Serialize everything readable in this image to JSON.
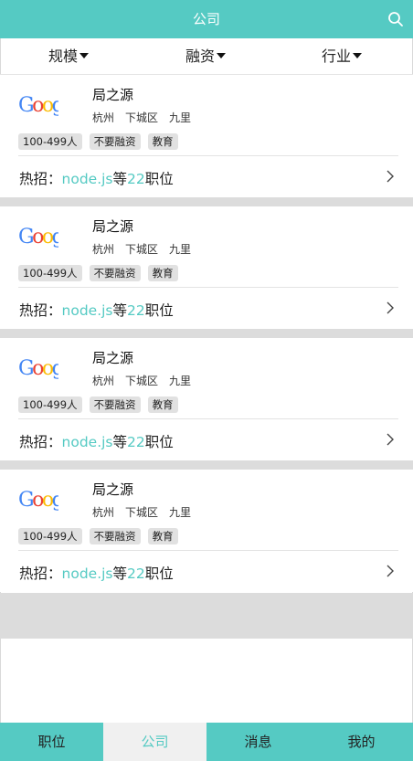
{
  "header": {
    "title": "公司"
  },
  "filters": [
    {
      "label": "规模"
    },
    {
      "label": "融资"
    },
    {
      "label": "行业"
    }
  ],
  "companies": [
    {
      "name": "局之源",
      "city": "杭州",
      "district": "下城区",
      "area": "九里",
      "tags": [
        "100-499人",
        "不要融资",
        "教育"
      ],
      "hot_prefix": "热招：",
      "hot_skill": "node.js",
      "hot_mid": "等",
      "hot_count": "22",
      "hot_suffix": "职位"
    },
    {
      "name": "局之源",
      "city": "杭州",
      "district": "下城区",
      "area": "九里",
      "tags": [
        "100-499人",
        "不要融资",
        "教育"
      ],
      "hot_prefix": "热招：",
      "hot_skill": "node.js",
      "hot_mid": "等",
      "hot_count": "22",
      "hot_suffix": "职位"
    },
    {
      "name": "局之源",
      "city": "杭州",
      "district": "下城区",
      "area": "九里",
      "tags": [
        "100-499人",
        "不要融资",
        "教育"
      ],
      "hot_prefix": "热招：",
      "hot_skill": "node.js",
      "hot_mid": "等",
      "hot_count": "22",
      "hot_suffix": "职位"
    },
    {
      "name": "局之源",
      "city": "杭州",
      "district": "下城区",
      "area": "九里",
      "tags": [
        "100-499人",
        "不要融资",
        "教育"
      ],
      "hot_prefix": "热招：",
      "hot_skill": "node.js",
      "hot_mid": "等",
      "hot_count": "22",
      "hot_suffix": "职位"
    }
  ],
  "tabs": [
    {
      "label": "职位"
    },
    {
      "label": "公司"
    },
    {
      "label": "消息"
    },
    {
      "label": "我的"
    }
  ],
  "colors": {
    "accent": "#55cac3",
    "separator": "#dcdcdc",
    "active_tab_bg": "#f0f0f0"
  },
  "icons": {
    "search": "search-icon",
    "logo": "google-logo",
    "chevron": "chevron-right-icon"
  }
}
